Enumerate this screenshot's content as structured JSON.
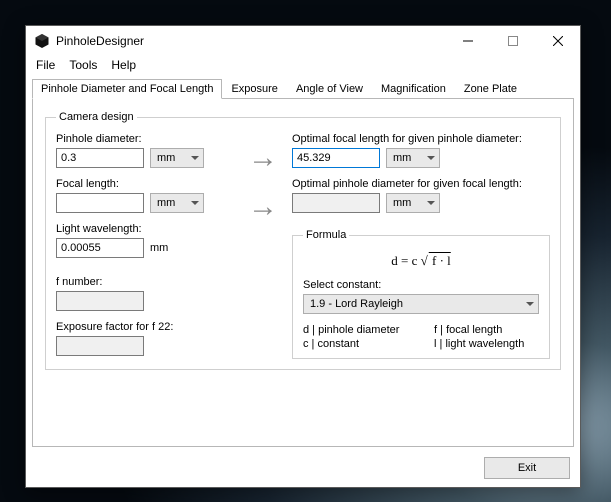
{
  "window": {
    "title": "PinholeDesigner"
  },
  "menu": {
    "file": "File",
    "tools": "Tools",
    "help": "Help"
  },
  "tabs": {
    "t0": "Pinhole Diameter and Focal Length",
    "t1": "Exposure",
    "t2": "Angle of View",
    "t3": "Magnification",
    "t4": "Zone Plate"
  },
  "group_camera_design": "Camera design",
  "labels": {
    "pinhole_diameter": "Pinhole diameter:",
    "focal_length": "Focal length:",
    "light_wavelength": "Light wavelength:",
    "f_number": "f number:",
    "exposure_factor": "Exposure factor for f 22:",
    "optimal_focal": "Optimal focal length for given pinhole diameter:",
    "optimal_diameter": "Optimal pinhole diameter for given focal length:",
    "select_constant": "Select constant:"
  },
  "values": {
    "pinhole_diameter": "0.3",
    "focal_length": "",
    "light_wavelength": "0.00055",
    "f_number": "",
    "exposure_factor": "",
    "optimal_focal": "45.329",
    "optimal_diameter": ""
  },
  "units": {
    "mm": "mm"
  },
  "formula": {
    "group": "Formula",
    "eq_lhs": "d = c ",
    "eq_rad": "√",
    "eq_under": " f · l ",
    "legend_d": "d | pinhole diameter",
    "legend_f": "f | focal length",
    "legend_c": "c | constant",
    "legend_l": "l | light wavelength"
  },
  "constant_selected": "1.9 - Lord Rayleigh",
  "exit": "Exit"
}
